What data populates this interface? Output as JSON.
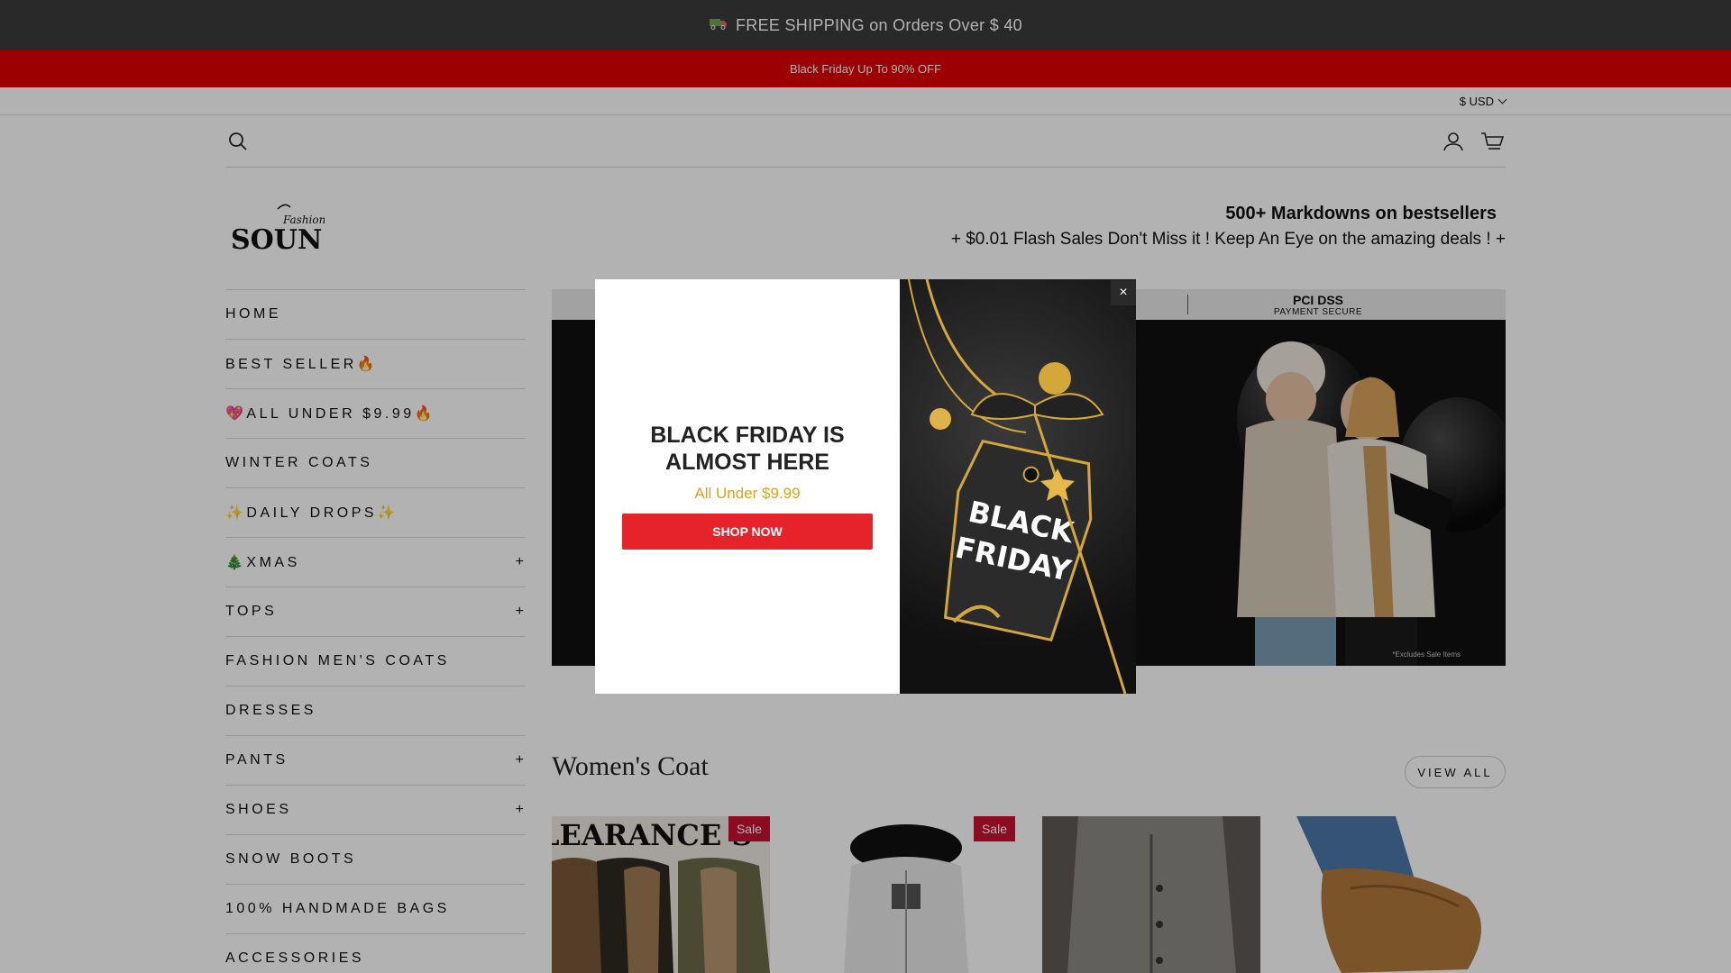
{
  "announcement": {
    "icon": "truck-icon",
    "text": "FREE SHIPPING on Orders Over $ 40"
  },
  "promo_bar": {
    "text": "Black Friday Up To 90% OFF"
  },
  "currency": {
    "label": "$ USD"
  },
  "header": {
    "search_icon": "search-icon",
    "account_icon": "account-icon",
    "cart_icon": "cart-icon"
  },
  "logo": {
    "small": "Fashion",
    "big": "SOUN"
  },
  "taglines": {
    "line1": "500+ Markdowns on bestsellers",
    "line2": "+ $0.01 Flash Sales Don't Miss it !  Keep An Eye on the amazing deals ! +"
  },
  "nav": [
    {
      "label": "Home",
      "expandable": false
    },
    {
      "label": "Best Seller🔥",
      "expandable": false
    },
    {
      "label": "💖All Under $9.99🔥",
      "expandable": false
    },
    {
      "label": "Winter Coats",
      "expandable": false
    },
    {
      "label": "✨Daily Drops✨",
      "expandable": false
    },
    {
      "label": "🎄Xmas",
      "expandable": true
    },
    {
      "label": "Tops",
      "expandable": true
    },
    {
      "label": "Fashion Men's Coats",
      "expandable": false
    },
    {
      "label": "Dresses",
      "expandable": false
    },
    {
      "label": "Pants",
      "expandable": true
    },
    {
      "label": "Shoes",
      "expandable": true
    },
    {
      "label": "Snow Boots",
      "expandable": false
    },
    {
      "label": "100% Handmade Bags",
      "expandable": false
    },
    {
      "label": "Accessories",
      "expandable": false
    }
  ],
  "nav_plus": "+",
  "hero": {
    "pci_title": "PCI DSS",
    "pci_sub": "PAYMENT SECURE",
    "note": "*Excludes Sale Items"
  },
  "popup": {
    "title_line1": "BLACK FRIDAY IS",
    "title_line2": "ALMOST HERE",
    "subtitle": "All Under $9.99",
    "button": "SHOP NOW",
    "tag_line1": "BLACK",
    "tag_line2": "FRIDAY",
    "close": "×"
  },
  "section": {
    "title": "Women's Coat",
    "view_all": "VIEW ALL"
  },
  "products": [
    {
      "badge": "Sale",
      "banner": "LEARANCE S"
    },
    {
      "badge": "Sale"
    },
    {
      "badge": ""
    },
    {
      "badge": ""
    }
  ],
  "colors": {
    "announcement_bg": "#3b3b3b",
    "promo_bg": "#e00000",
    "button_red": "#e6232a",
    "sale_badge": "#c8102e",
    "gold": "#d9a31a"
  }
}
